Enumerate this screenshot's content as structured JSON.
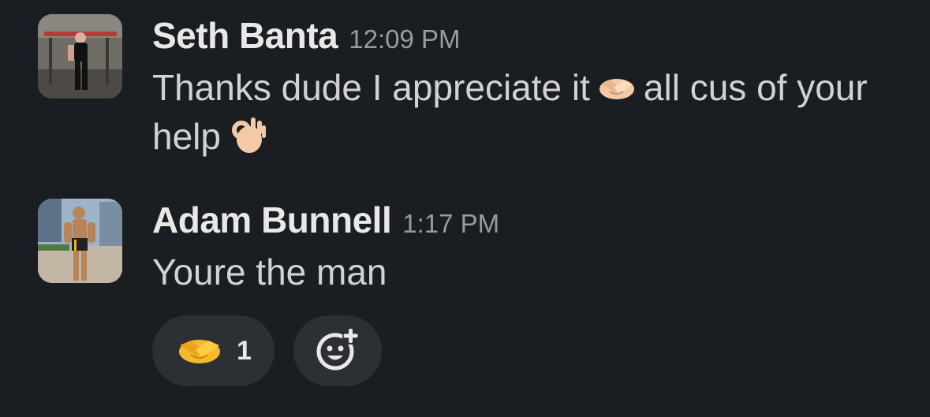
{
  "messages": [
    {
      "author": "Seth Banta",
      "time": "12:09 PM",
      "text_part1": "Thanks dude I appreciate it",
      "text_part2": "all cus of your help",
      "emoji1": "handshake-icon",
      "emoji2": "ok-hand-icon"
    },
    {
      "author": "Adam Bunnell",
      "time": "1:17 PM",
      "text": "Youre the man"
    }
  ],
  "reactions": [
    {
      "emoji": "handshake-icon",
      "count": "1"
    }
  ],
  "add_reaction_icon": "add-reaction-icon",
  "colors": {
    "background": "#1a1d21",
    "pill": "#2c2f33",
    "text": "#d1d2d3",
    "author": "#e8e8e8",
    "timestamp": "#9a9b9d",
    "reaction_yellow": "#f7b82a"
  }
}
